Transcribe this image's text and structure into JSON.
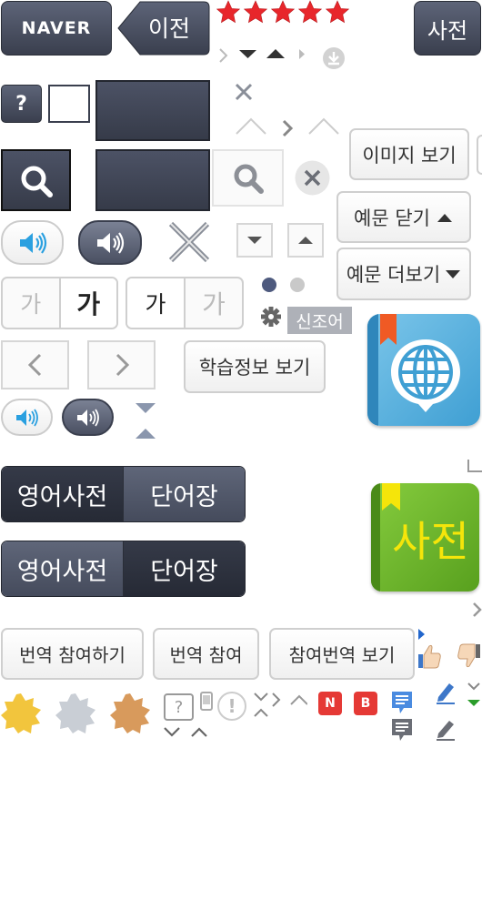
{
  "header": {
    "naver_label": "NAVER",
    "prev_label": "이전",
    "dict_label": "사전",
    "rating_stars": 5
  },
  "buttons": {
    "view_image": "이미지 보기",
    "close_example": "예문 닫기",
    "more_example": "예문 더보기",
    "learning_info": "학습정보 보기",
    "join_translation": "번역 참여하기",
    "translation_join": "번역 참여",
    "view_joined_translation": "참여번역 보기"
  },
  "help_label": "?",
  "font_toggle": {
    "small": "가",
    "large": "가"
  },
  "new_word_label": "신조어",
  "tabs": {
    "english_dict": "영어사전",
    "wordbook": "단어장"
  },
  "dict_app_label": "사전",
  "badges": {
    "n": "N",
    "b": "B"
  },
  "help_outline_label": "?",
  "alert_label": "!",
  "colors": {
    "dark_button": "#3f4454",
    "star_red": "#e8262b",
    "app_blue": "#5bb3df",
    "app_green": "#6ab22a",
    "dict_text_yellow": "#f5e50a",
    "badge_red": "#e53935",
    "gold": "#f2c53d",
    "silver": "#c9ced5",
    "bronze": "#d89a5c",
    "pencil_blue": "#3d77c9",
    "green_arrow": "#2a9c2a"
  }
}
